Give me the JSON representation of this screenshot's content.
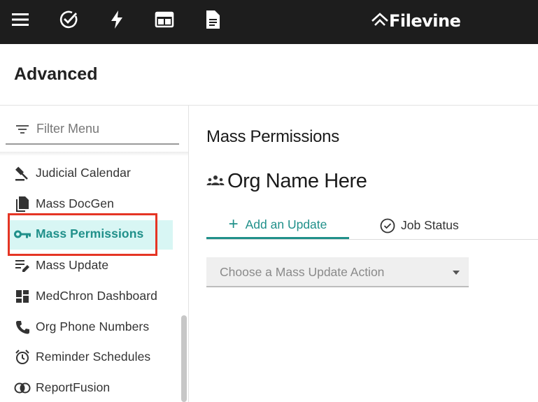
{
  "brand": {
    "name": "Filevine"
  },
  "topbar": {
    "icons": [
      "menu-icon",
      "check-circle-icon",
      "lightning-icon",
      "layout-icon",
      "document-icon"
    ]
  },
  "page": {
    "title": "Advanced"
  },
  "sidebar": {
    "filter_placeholder": "Filter Menu",
    "items": [
      {
        "label": "Judicial Calendar",
        "icon": "gavel-icon"
      },
      {
        "label": "Mass DocGen",
        "icon": "documents-icon"
      },
      {
        "label": "Mass Permissions",
        "icon": "key-icon",
        "active": true
      },
      {
        "label": "Mass Update",
        "icon": "edit-list-icon"
      },
      {
        "label": "MedChron Dashboard",
        "icon": "dashboard-icon"
      },
      {
        "label": "Org Phone Numbers",
        "icon": "phone-icon"
      },
      {
        "label": "Reminder Schedules",
        "icon": "alarm-icon"
      },
      {
        "label": "ReportFusion",
        "icon": "report-fusion-icon"
      }
    ]
  },
  "main": {
    "section_title": "Mass Permissions",
    "org_name": "Org Name Here",
    "tabs": [
      {
        "label": "Add an Update",
        "active": true
      },
      {
        "label": "Job Status"
      }
    ],
    "action_select": {
      "placeholder": "Choose a Mass Update Action"
    }
  },
  "colors": {
    "topbar": "#1d1d1d",
    "accent": "#20908a",
    "active_bg": "#d8f6f4",
    "annotation_red": "#e53524"
  }
}
